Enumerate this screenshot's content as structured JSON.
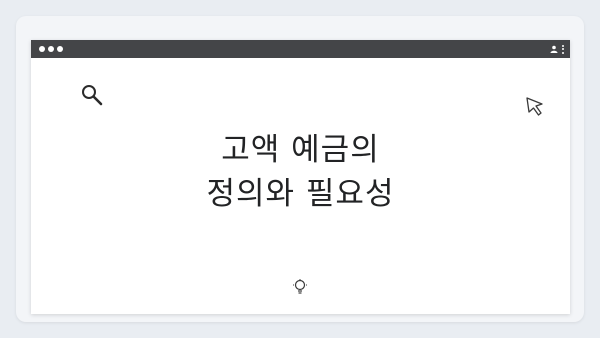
{
  "window": {
    "title_line1": "고액 예금의",
    "title_line2": "정의와 필요성"
  },
  "icons": {
    "search": "search-icon",
    "cursor": "cursor-icon",
    "bulb": "lightbulb-icon",
    "user": "user-icon",
    "menu": "kebab-menu-icon"
  },
  "colors": {
    "titlebar": "#444548",
    "background": "#e9edf2",
    "panel": "#ffffff",
    "text": "#222325"
  }
}
